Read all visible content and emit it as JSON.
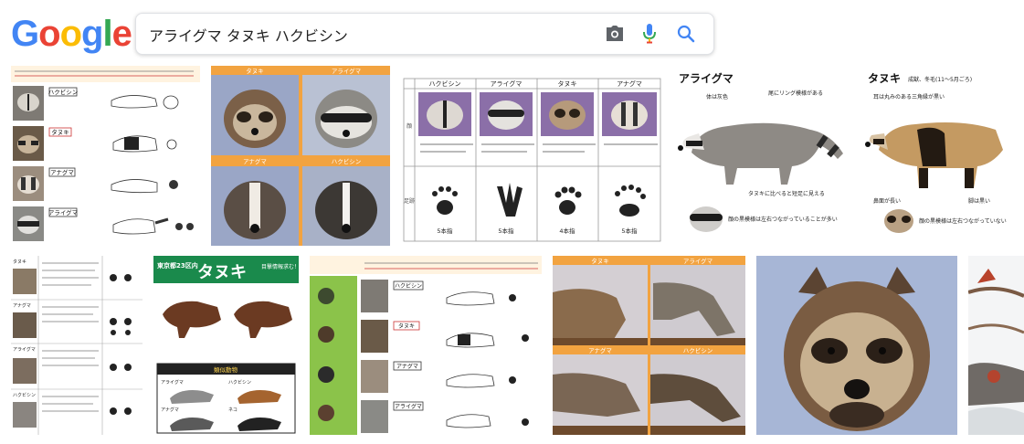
{
  "logo": {
    "letters": [
      "G",
      "o",
      "o",
      "g",
      "l",
      "e"
    ],
    "colors": [
      "#4285F4",
      "#EA4335",
      "#FBBC05",
      "#4285F4",
      "#34A853",
      "#EA4335"
    ]
  },
  "search": {
    "query": "アライグマ タヌキ ハクビシン"
  },
  "icons": {
    "camera": "camera-icon",
    "mic": "microphone-icon",
    "search": "search-icon"
  },
  "results": [
    {
      "id": "r1",
      "labels": [
        "ハクビシン",
        "タヌキ",
        "アナグマ",
        "アライグマ"
      ]
    },
    {
      "id": "r2",
      "labels": [
        "タヌキ",
        "アライグマ",
        "アナグマ",
        "ハクビシン"
      ]
    },
    {
      "id": "r3",
      "headers": [
        "ハクビシン",
        "アライグマ",
        "タヌキ",
        "アナグマ"
      ],
      "row_labels": [
        "顔",
        "足跡"
      ],
      "captions": [
        "5本指",
        "5本指",
        "4本指",
        "5本指"
      ]
    },
    {
      "id": "r4",
      "title": "アライグマ",
      "notes": [
        "体は灰色",
        "尾にリング模様がある",
        "タヌキに比べると短足に見える",
        "顔の黒模様は左右つながっていることが多い"
      ]
    },
    {
      "id": "r5",
      "title": "タヌキ",
      "subtitle": "成獣、冬毛(11～5月ごろ)",
      "notes": [
        "耳は丸みのある三角縁が黒い",
        "鼻面が長い",
        "顔の黒模様は左右つながっていない",
        "脚は黒い"
      ]
    },
    {
      "id": "r6",
      "labels": [
        "タヌキ",
        "アナグマ",
        "アライグマ",
        "ハクビシン"
      ]
    },
    {
      "id": "r7",
      "title": "東京都23区内",
      "big": "タヌキ",
      "badge": "目撃情報求む！",
      "section": "類似動物",
      "animals": [
        "アライグマ",
        "ハクビシン",
        "アナグマ",
        "ネコ"
      ]
    },
    {
      "id": "r8",
      "labels": [
        "ハクビシン",
        "タヌキ",
        "アナグマ",
        "アライグマ"
      ]
    },
    {
      "id": "r9",
      "labels": [
        "タヌキ",
        "アライグマ",
        "アナグマ",
        "ハクビシン"
      ]
    },
    {
      "id": "r10"
    },
    {
      "id": "r11"
    }
  ]
}
